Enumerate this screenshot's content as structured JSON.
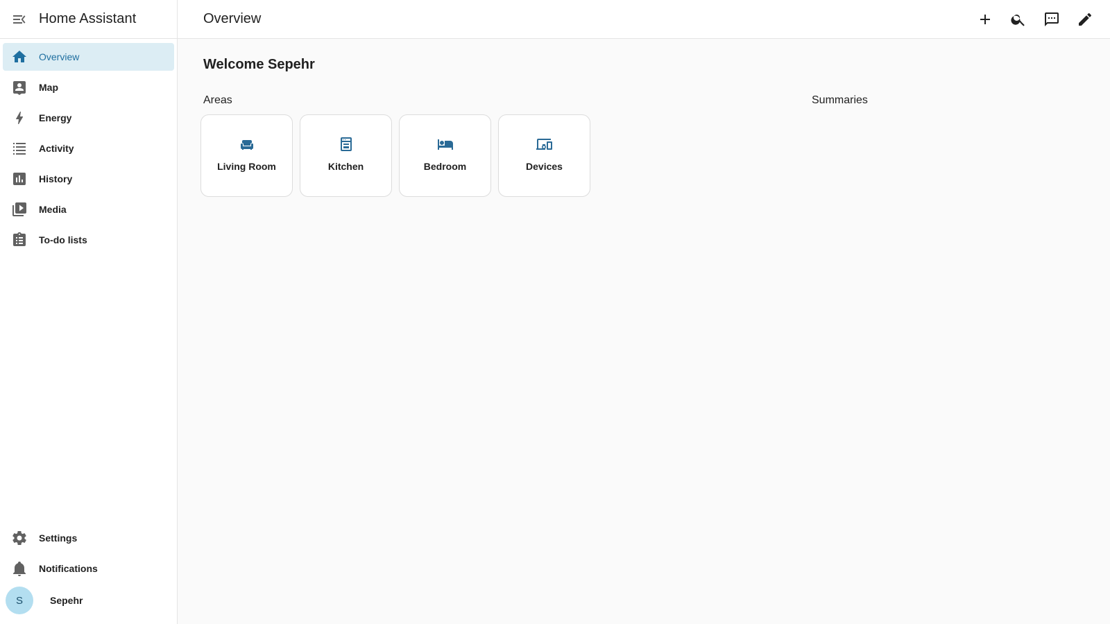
{
  "app": {
    "title": "Home Assistant"
  },
  "sidebar": {
    "items": [
      {
        "label": "Overview",
        "icon": "home-icon",
        "active": true
      },
      {
        "label": "Map",
        "icon": "map-person-icon"
      },
      {
        "label": "Energy",
        "icon": "lightning-bolt-icon"
      },
      {
        "label": "Activity",
        "icon": "format-list-icon"
      },
      {
        "label": "History",
        "icon": "chart-box-icon"
      },
      {
        "label": "Media",
        "icon": "play-box-multiple-icon"
      },
      {
        "label": "To-do lists",
        "icon": "clipboard-list-icon"
      }
    ],
    "bottom": [
      {
        "label": "Settings",
        "icon": "gear-icon"
      },
      {
        "label": "Notifications",
        "icon": "bell-icon"
      }
    ],
    "user": {
      "initial": "S",
      "name": "Sepehr"
    }
  },
  "header": {
    "title": "Overview",
    "actions": [
      "add-icon",
      "search-icon",
      "assist-chat-icon",
      "edit-pencil-icon"
    ]
  },
  "main": {
    "welcome": "Welcome Sepehr",
    "areas_title": "Areas",
    "summaries_title": "Summaries",
    "areas": [
      {
        "label": "Living Room",
        "icon": "sofa-icon"
      },
      {
        "label": "Kitchen",
        "icon": "stove-icon"
      },
      {
        "label": "Bedroom",
        "icon": "bed-icon"
      },
      {
        "label": "Devices",
        "icon": "devices-icon"
      }
    ]
  },
  "colors": {
    "accent": "#1f6fa0",
    "active_bg": "#dcedf4",
    "avatar_bg": "#b3def0",
    "card_icon": "#2a6a96"
  }
}
